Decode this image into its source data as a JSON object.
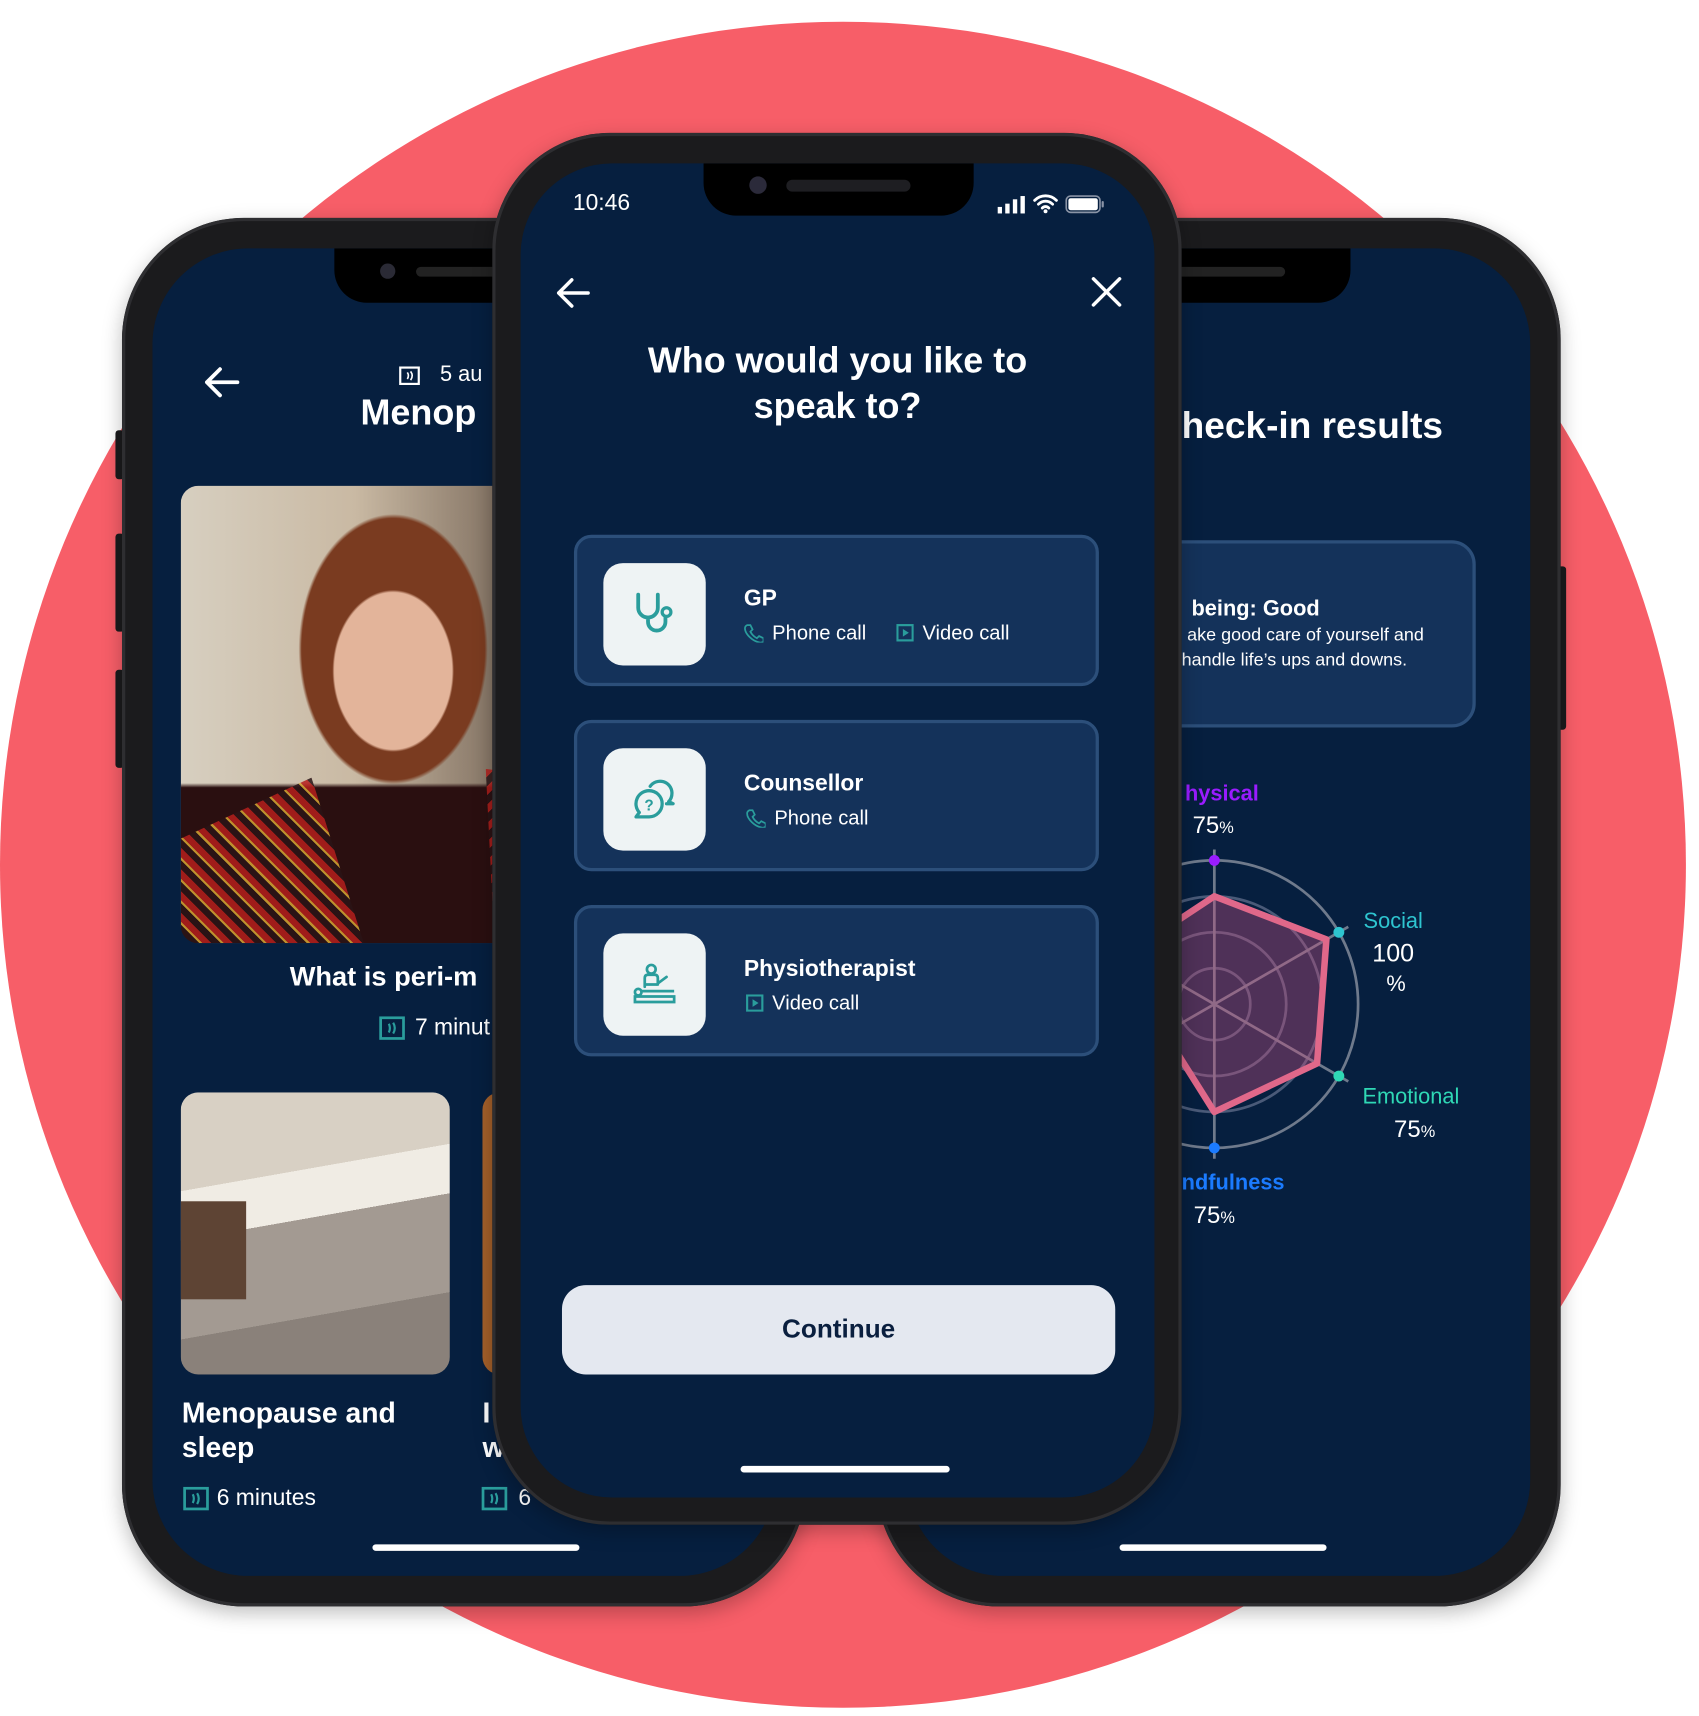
{
  "colors": {
    "background_circle": "#f75e68",
    "screen_bg": "#061f3f",
    "card_bg": "#14325a",
    "card_border": "#2c4f7a",
    "accent_teal": "#2a9d9c",
    "button_bg": "#e4e8f0",
    "physical": "#9a1cff",
    "social": "#2ec5d0",
    "emotional": "#2fd8b5",
    "mindfulness": "#1b7bff",
    "radar_stroke": "#e0688a"
  },
  "center_phone": {
    "status_bar": {
      "time": "10:46",
      "icons": [
        "signal-icon",
        "wifi-icon",
        "battery-icon"
      ]
    },
    "nav": {
      "back_icon": "arrow-left-icon",
      "close_icon": "close-icon"
    },
    "title": "Who would you like to speak to?",
    "options": [
      {
        "title": "GP",
        "icon": "stethoscope-icon",
        "channels": [
          {
            "label": "Phone call",
            "icon": "phone-icon"
          },
          {
            "label": "Video call",
            "icon": "video-icon"
          }
        ]
      },
      {
        "title": "Counsellor",
        "icon": "speech-bubbles-question-icon",
        "channels": [
          {
            "label": "Phone call",
            "icon": "phone-icon"
          }
        ]
      },
      {
        "title": "Physiotherapist",
        "icon": "physiotherapy-icon",
        "channels": [
          {
            "label": "Video call",
            "icon": "video-icon"
          }
        ]
      }
    ],
    "continue_label": "Continue"
  },
  "left_phone": {
    "back_icon": "arrow-left-icon",
    "header_meta": "5 au",
    "header_title": "Menop",
    "featured": {
      "title": "What is peri-m",
      "duration": "7 minut"
    },
    "cards": [
      {
        "title_line1": "Menopause  and",
        "title_line2": "sleep",
        "duration": "6 minutes"
      },
      {
        "title_line1": "I",
        "title_line2": "w",
        "duration": "6"
      }
    ]
  },
  "right_phone": {
    "title": "heck-in results",
    "summary": {
      "heading": "being: Good",
      "line1": "ake good care of yourself and",
      "line2": "handle life’s ups and downs."
    },
    "radar": {
      "max": 100,
      "axes": [
        {
          "label": "hysical",
          "value": 75,
          "value_text": "75",
          "unit": "%"
        },
        {
          "label": "Social",
          "value": 100,
          "value_text": "100",
          "unit": "%"
        },
        {
          "label": "Emotional",
          "value": 75,
          "value_text": "75",
          "unit": "%"
        },
        {
          "label": "ndfulness",
          "value": 75,
          "value_text": "75",
          "unit": "%"
        }
      ]
    }
  }
}
